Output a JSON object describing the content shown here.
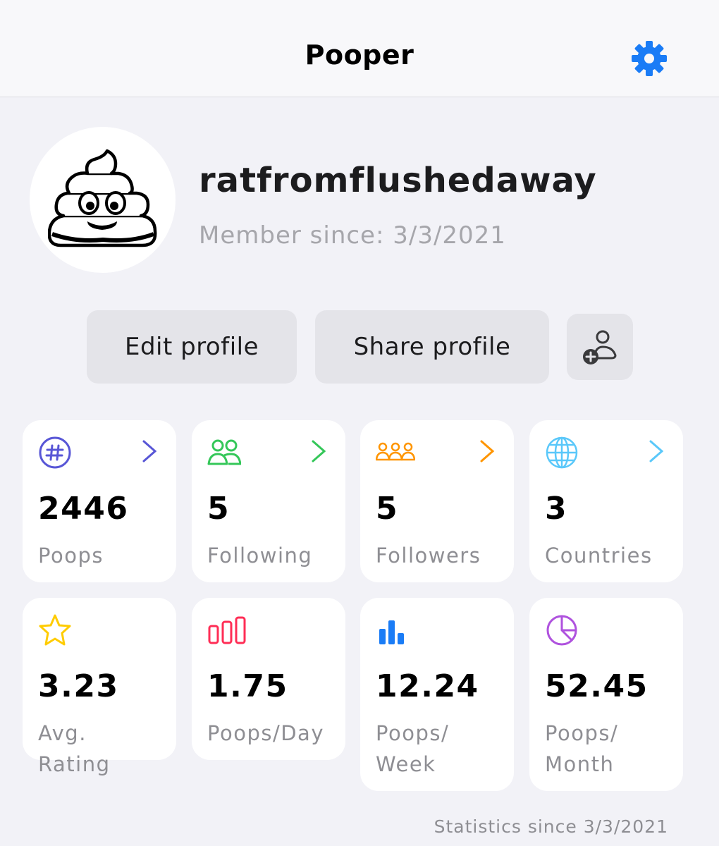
{
  "header": {
    "title": "Pooper",
    "settings_icon": "gear-icon",
    "accent_color": "#1a7cf6"
  },
  "profile": {
    "username": "ratfromflushedaway",
    "member_since": "Member since: 3/3/2021",
    "avatar_icon": "pile-of-poo-icon"
  },
  "actions": {
    "edit_label": "Edit profile",
    "share_label": "Share profile",
    "add_friend_icon": "add-person-icon"
  },
  "stats": [
    {
      "value": "2446",
      "label": "Poops",
      "icon": "hashtag-icon",
      "color": "#5856d6"
    },
    {
      "value": "5",
      "label": "Following",
      "icon": "people-icon",
      "color": "#34c759"
    },
    {
      "value": "5",
      "label": "Followers",
      "icon": "group-icon",
      "color": "#ff9500"
    },
    {
      "value": "3",
      "label": "Countries",
      "icon": "globe-icon",
      "color": "#5ac8fa"
    },
    {
      "value": "3.23",
      "label": "Avg. Rating",
      "icon": "star-icon",
      "color": "#ffcc00"
    },
    {
      "value": "1.75",
      "label": "Poops/Day",
      "icon": "bars-outline-icon",
      "color": "#ff2d55"
    },
    {
      "value": "12.24",
      "label": "Poops/ Week",
      "icon": "bar-chart-icon",
      "color": "#1a7cf6"
    },
    {
      "value": "52.45",
      "label": "Poops/ Month",
      "icon": "pie-chart-icon",
      "color": "#af52de"
    }
  ],
  "footer": {
    "text": "Statistics since 3/3/2021"
  }
}
